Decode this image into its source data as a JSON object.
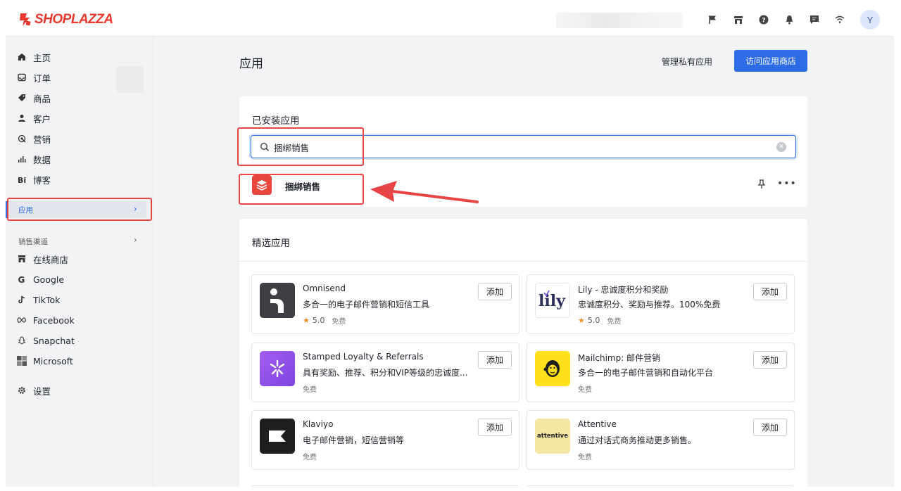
{
  "brand": {
    "logo_text": "SHOPLAZZA",
    "color": "#e8392f"
  },
  "topbar": {
    "icons": [
      "flag-icon",
      "store-icon",
      "help-icon",
      "bell-icon",
      "chat-icon",
      "wifi-icon"
    ],
    "avatar": "Y"
  },
  "sidebar": {
    "items": [
      {
        "label": "主页",
        "icon": "home-icon"
      },
      {
        "label": "订单",
        "icon": "inbox-icon"
      },
      {
        "label": "商品",
        "icon": "tag-icon"
      },
      {
        "label": "客户",
        "icon": "person-icon"
      },
      {
        "label": "营销",
        "icon": "marketing-icon"
      },
      {
        "label": "数据",
        "icon": "bar-chart-icon"
      },
      {
        "label": "博客",
        "icon": "blog-icon"
      }
    ],
    "active": {
      "label": "应用",
      "chevron": "›"
    },
    "channels_title": "销售渠道",
    "channels_chevron": "›",
    "channels": [
      {
        "label": "在线商店",
        "icon": "store-icon"
      },
      {
        "label": "Google",
        "icon": "google-icon"
      },
      {
        "label": "TikTok",
        "icon": "tiktok-icon"
      },
      {
        "label": "Facebook",
        "icon": "meta-icon"
      },
      {
        "label": "Snapchat",
        "icon": "snapchat-icon"
      },
      {
        "label": "Microsoft",
        "icon": "microsoft-icon"
      }
    ],
    "settings": {
      "label": "设置",
      "icon": "gear-icon"
    }
  },
  "main": {
    "title": "应用",
    "manage_private": "管理私有应用",
    "visit_store": "访问应用商店",
    "installed": {
      "title": "已安装应用",
      "search_value": "捆绑销售",
      "app_name": "捆绑销售"
    },
    "featured": {
      "title": "精选应用",
      "add_label": "添加",
      "apps": [
        {
          "name": "Omnisend",
          "desc": "多合一的电子邮件营销和短信工具",
          "rating": "5.0",
          "price": "免费",
          "has_rating": true
        },
        {
          "name": "Lily - 忠诚度积分和奖励",
          "desc": "忠诚度积分、奖励与推荐。100%免费",
          "rating": "5.0",
          "price": "免费",
          "has_rating": true
        },
        {
          "name": "Stamped Loyalty & Referrals",
          "desc": "具有奖励、推荐、积分和VIP等级的忠诚度...",
          "price": "免费",
          "has_rating": false
        },
        {
          "name": "Mailchimp: 邮件营销",
          "desc": "多合一的电子邮件营销和自动化平台",
          "price": "免费",
          "has_rating": false
        },
        {
          "name": "Klaviyo",
          "desc": "电子邮件营销，短信营销等",
          "price": "免费",
          "has_rating": false
        },
        {
          "name": "Attentive",
          "desc": "通过对话式商务推动更多销售。",
          "price": "免费",
          "has_rating": false,
          "logo_text": "attentive"
        }
      ]
    }
  },
  "colors": {
    "accent": "#2e6be6",
    "annotation": "#e64545",
    "bundle_icon": "#e8453c"
  }
}
